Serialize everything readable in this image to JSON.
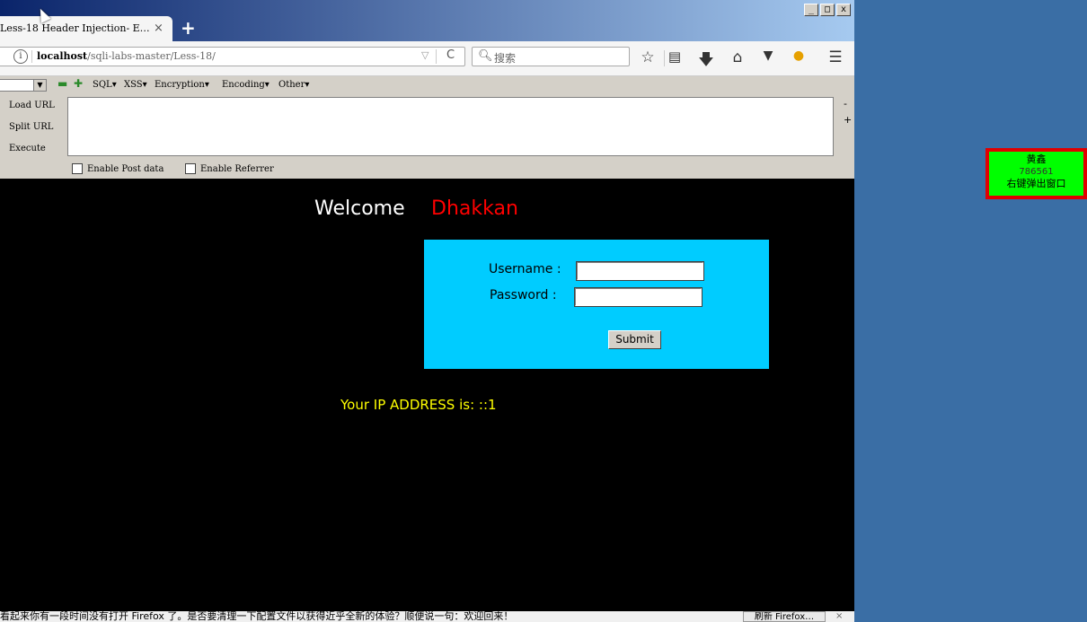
{
  "window": {
    "min_label": "_",
    "max_label": "□",
    "close_label": "x"
  },
  "tab": {
    "title": "Less-18 Header Injection- E…",
    "close": "×",
    "new_tab": "+"
  },
  "address_bar": {
    "info": "i",
    "host": "localhost",
    "path": "/sqli-labs-master/Less-18/",
    "dropdown": "▽",
    "reload": "C"
  },
  "search": {
    "icon": "search-icon",
    "placeholder": "搜索"
  },
  "toolbar_icons": [
    "star-icon",
    "reading-list-icon",
    "download-icon",
    "home-icon",
    "pocket-icon",
    "extension-icon",
    "menu-icon"
  ],
  "hackbar": {
    "minus": "▬",
    "plus": "✚",
    "menus": [
      "SQL▾",
      "XSS▾",
      "Encryption▾",
      "Encoding▾",
      "Other▾"
    ],
    "load_url": "Load URL",
    "split_url": "Split URL",
    "execute": "Execute",
    "side_minus": "-",
    "side_plus": "+",
    "enable_post": "Enable Post data",
    "enable_referrer": "Enable Referrer"
  },
  "page": {
    "welcome": "Welcome",
    "name": "Dhakkan",
    "username_label": "Username :",
    "password_label": "Password :",
    "submit": "Submit",
    "ip_text": "Your IP ADDRESS is: ::1"
  },
  "statusbar": {
    "message": "看起来你有一段时间没有打开 Firefox 了。是否要清理一下配置文件以获得近乎全新的体验？顺便说一句：欢迎回来！",
    "button": "刷新 Firefox…",
    "close": "×"
  },
  "widget": {
    "name": "黄鑫",
    "number": "786561",
    "hint": "右键弹出窗口"
  },
  "colors": {
    "page_bg": "#000000",
    "login_bg": "#00ccff",
    "name_color": "#ff0000",
    "ip_color": "#ffff00",
    "widget_bg": "#00ff00",
    "widget_border": "#e00000",
    "desktop": "#3a6ea5"
  }
}
